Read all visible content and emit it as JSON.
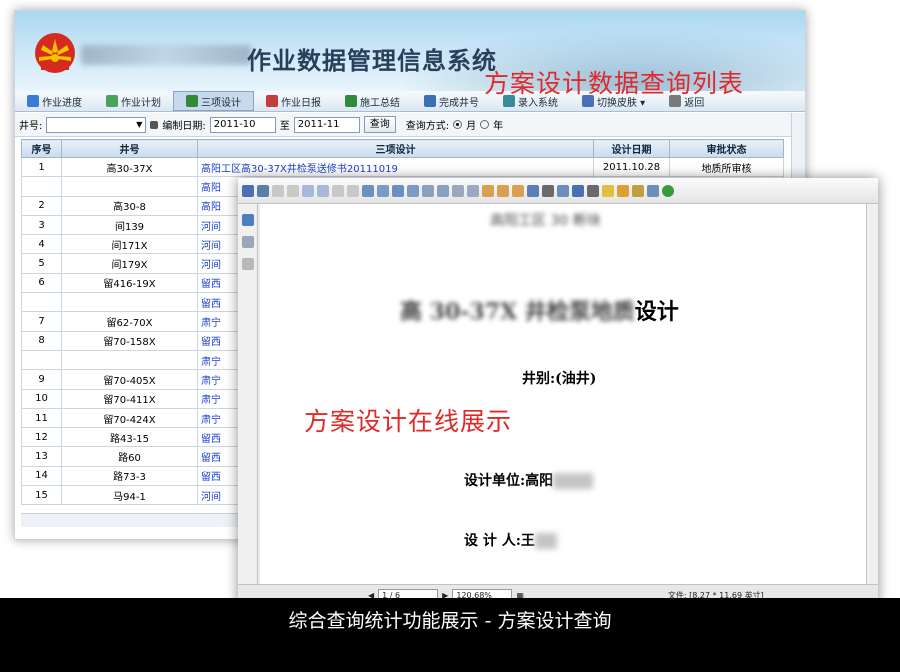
{
  "app": {
    "title": "作业数据管理信息系统",
    "title_prefix": "第 井下"
  },
  "nav": [
    {
      "label": "作业进度",
      "color": "#3a7bd5"
    },
    {
      "label": "作业计划",
      "color": "#4aa35b"
    },
    {
      "label": "三项设计",
      "color": "#2f8a3a",
      "active": true
    },
    {
      "label": "作业日报",
      "color": "#c43c3c"
    },
    {
      "label": "施工总结",
      "color": "#2f8a3a"
    },
    {
      "label": "完成井号",
      "color": "#3a6fb5"
    },
    {
      "label": "录入系统",
      "color": "#3a8a9a"
    },
    {
      "label": "切换皮肤 ▾",
      "color": "#4a6fb5"
    },
    {
      "label": "返回",
      "color": "#7a7a7a"
    }
  ],
  "filter": {
    "well_label": "井号:",
    "well_value": "",
    "date_label": "编制日期:",
    "date_from": "2011-10",
    "date_to_label": "至",
    "date_to": "2011-11",
    "query_button": "查询",
    "mode_label": "查询方式:",
    "mode_month": "月",
    "mode_year": "年",
    "selected_mode": "月"
  },
  "table": {
    "headers": [
      "序号",
      "井号",
      "三项设计",
      "设计日期",
      "审批状态"
    ],
    "rows": [
      [
        "1",
        "高30-37X",
        "高阳工区高30-37X井检泵送修书20111019",
        "2011.10.28",
        "地质所审核"
      ],
      [
        "",
        "",
        "高阳",
        "",
        ""
      ],
      [
        "2",
        "高30-8",
        "高阳",
        "",
        ""
      ],
      [
        "3",
        "间139",
        "河间",
        "",
        ""
      ],
      [
        "4",
        "间171X",
        "河间",
        "",
        ""
      ],
      [
        "5",
        "间179X",
        "河间",
        "",
        ""
      ],
      [
        "6",
        "留416-19X",
        "留西",
        "",
        ""
      ],
      [
        "",
        "",
        "留西",
        "",
        ""
      ],
      [
        "7",
        "留62-70X",
        "肃宁",
        "",
        ""
      ],
      [
        "8",
        "留70-158X",
        "留西",
        "",
        ""
      ],
      [
        "",
        "",
        "肃宁",
        "",
        ""
      ],
      [
        "9",
        "留70-405X",
        "肃宁",
        "",
        ""
      ],
      [
        "10",
        "留70-411X",
        "肃宁",
        "",
        ""
      ],
      [
        "11",
        "留70-424X",
        "肃宁",
        "",
        ""
      ],
      [
        "12",
        "路43-15",
        "留西",
        "",
        ""
      ],
      [
        "13",
        "路60",
        "留西",
        "",
        ""
      ],
      [
        "14",
        "路73-3",
        "留西",
        "",
        ""
      ],
      [
        "15",
        "马94-1",
        "河间",
        "",
        ""
      ]
    ]
  },
  "pdf": {
    "header": "高阳工区 30 断块",
    "title_blur": "高 30-37X 井检泵地质",
    "title": "设计",
    "well_type": "井别:(油井)",
    "unit_label": "设计单位:",
    "unit_value": "高阳",
    "person_label": "设 计 人:",
    "person_value": "王",
    "page": "1 / 6",
    "zoom": "120.68%",
    "file_info": "文件: [8.27 * 11.69 英寸]"
  },
  "annotations": {
    "list_label": "方案设计数据查询列表",
    "online_label": "方案设计在线展示"
  },
  "caption": "综合查询统计功能展示 - 方案设计查询"
}
